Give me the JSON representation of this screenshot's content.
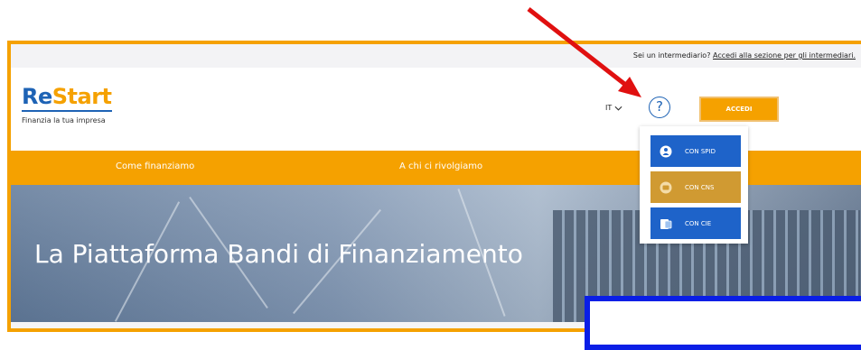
{
  "topbar": {
    "question": "Sei un intermediario?",
    "link": "Accedi alla sezione per gli intermediari."
  },
  "header": {
    "logo_re": "Re",
    "logo_start": "Start",
    "tagline": "Finanzia la tua impresa",
    "language": "IT",
    "help_symbol": "?",
    "login_button": "ACCEDI"
  },
  "nav": {
    "items": [
      {
        "label": "Come finanziamo"
      },
      {
        "label": "A chi ci rivolgiamo"
      }
    ]
  },
  "hero": {
    "title": "La Piattaforma Bandi di Finanziamento"
  },
  "login_menu": {
    "options": [
      {
        "label": "CON SPID",
        "icon": "spid-user-icon",
        "color": "#1e63c9"
      },
      {
        "label": "CON CNS",
        "icon": "cns-card-icon",
        "color": "#d09a32"
      },
      {
        "label": "CON CIE",
        "icon": "cie-card-icon",
        "color": "#1e63c9"
      }
    ]
  },
  "colors": {
    "brand_orange": "#f5a100",
    "brand_blue": "#1e63b5",
    "annotation_red": "#e01010",
    "annotation_blue": "#0a1ee6"
  }
}
